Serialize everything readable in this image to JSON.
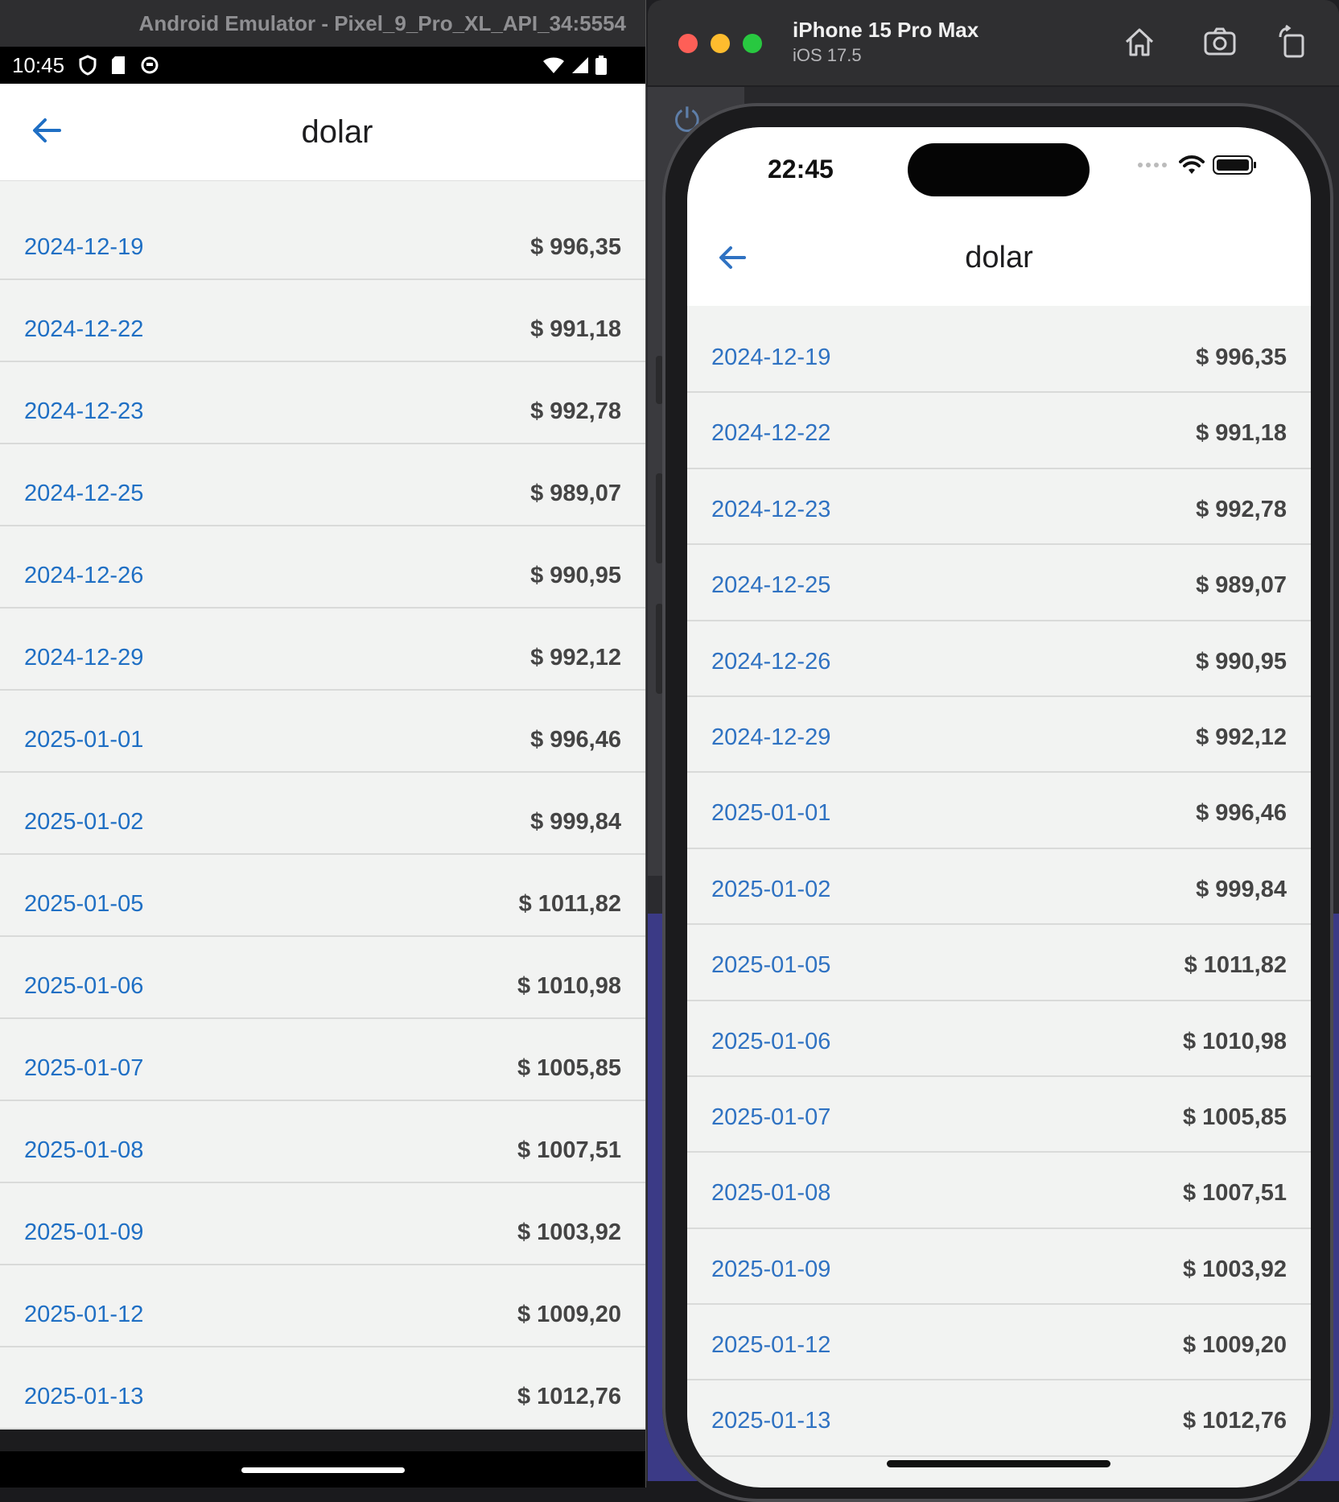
{
  "android": {
    "window_title": "Android Emulator - Pixel_9_Pro_XL_API_34:5554",
    "status_time": "10:45",
    "app_title": "dolar",
    "rows": [
      {
        "date": "2024-12-19",
        "value": "$ 996,35"
      },
      {
        "date": "2024-12-22",
        "value": "$ 991,18"
      },
      {
        "date": "2024-12-23",
        "value": "$ 992,78"
      },
      {
        "date": "2024-12-25",
        "value": "$ 989,07"
      },
      {
        "date": "2024-12-26",
        "value": "$ 990,95"
      },
      {
        "date": "2024-12-29",
        "value": "$ 992,12"
      },
      {
        "date": "2025-01-01",
        "value": "$ 996,46"
      },
      {
        "date": "2025-01-02",
        "value": "$ 999,84"
      },
      {
        "date": "2025-01-05",
        "value": "$ 1011,82"
      },
      {
        "date": "2025-01-06",
        "value": "$ 1010,98"
      },
      {
        "date": "2025-01-07",
        "value": "$ 1005,85"
      },
      {
        "date": "2025-01-08",
        "value": "$ 1007,51"
      },
      {
        "date": "2025-01-09",
        "value": "$ 1003,92"
      },
      {
        "date": "2025-01-12",
        "value": "$ 1009,20"
      },
      {
        "date": "2025-01-13",
        "value": "$ 1012,76"
      }
    ]
  },
  "ios": {
    "device_name": "iPhone 15 Pro Max",
    "os_version": "iOS 17.5",
    "status_time": "22:45",
    "app_title": "dolar",
    "rows": [
      {
        "date": "2024-12-19",
        "value": "$ 996,35"
      },
      {
        "date": "2024-12-22",
        "value": "$ 991,18"
      },
      {
        "date": "2024-12-23",
        "value": "$ 992,78"
      },
      {
        "date": "2024-12-25",
        "value": "$ 989,07"
      },
      {
        "date": "2024-12-26",
        "value": "$ 990,95"
      },
      {
        "date": "2024-12-29",
        "value": "$ 992,12"
      },
      {
        "date": "2025-01-01",
        "value": "$ 996,46"
      },
      {
        "date": "2025-01-02",
        "value": "$ 999,84"
      },
      {
        "date": "2025-01-05",
        "value": "$ 1011,82"
      },
      {
        "date": "2025-01-06",
        "value": "$ 1010,98"
      },
      {
        "date": "2025-01-07",
        "value": "$ 1005,85"
      },
      {
        "date": "2025-01-08",
        "value": "$ 1007,51"
      },
      {
        "date": "2025-01-09",
        "value": "$ 1003,92"
      },
      {
        "date": "2025-01-12",
        "value": "$ 1009,20"
      },
      {
        "date": "2025-01-13",
        "value": "$ 1012,76"
      }
    ]
  },
  "colors": {
    "link_blue": "#1f6fc4",
    "list_bg": "#f2f3f2",
    "divider": "#d9dad9",
    "value_text": "#444444"
  },
  "icons": {
    "android_back": "arrow-left-icon",
    "ios_back": "arrow-left-icon",
    "home": "home-icon",
    "screenshot": "camera-icon",
    "rotate": "rotate-icon"
  }
}
